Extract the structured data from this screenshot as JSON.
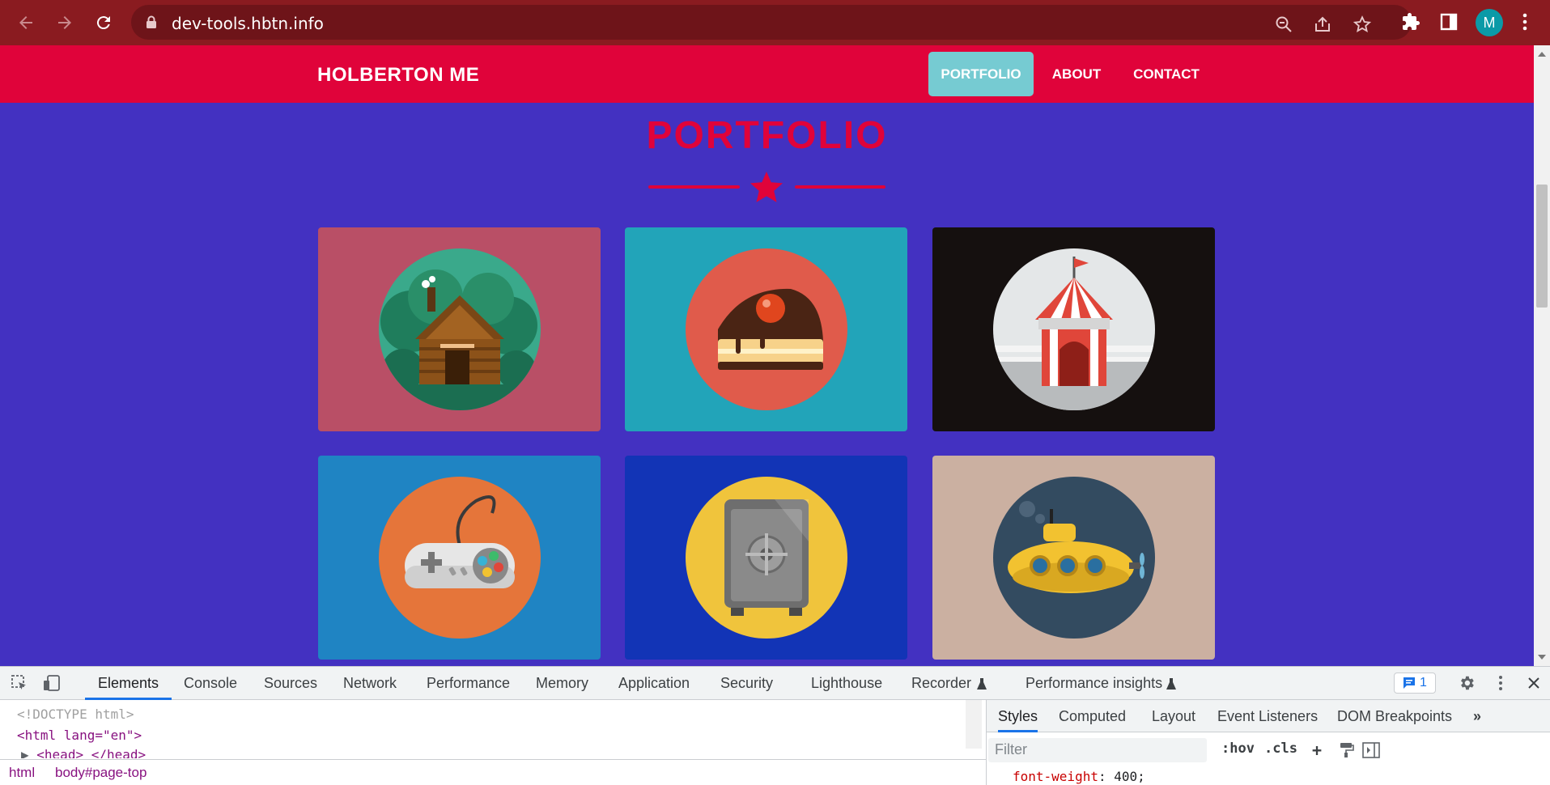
{
  "browser": {
    "url": "dev-tools.hbtn.info",
    "profile_initial": "M"
  },
  "site": {
    "brand": "HOLBERTON ME",
    "menu": [
      "PORTFOLIO",
      "ABOUT",
      "CONTACT"
    ],
    "active_menu": "PORTFOLIO",
    "section_title": "PORTFOLIO",
    "portfolio_items": [
      {
        "icon": "log-cabin-icon",
        "card_color": "#b94f66",
        "circle_color": "#3aa98b"
      },
      {
        "icon": "cake-slice-icon",
        "card_color": "#22a4b9",
        "circle_color": "#e05b4b"
      },
      {
        "icon": "circus-tent-icon",
        "card_color": "#15100f",
        "circle_color": "#e4e7e8"
      },
      {
        "icon": "game-controller-icon",
        "card_color": "#1f84c3",
        "circle_color": "#e5753a"
      },
      {
        "icon": "safe-icon",
        "card_color": "#1234b6",
        "circle_color": "#f0c43c"
      },
      {
        "icon": "submarine-icon",
        "card_color": "#cbb0a1",
        "circle_color": "#334b60"
      }
    ],
    "colors": {
      "page_bg": "#4331c1",
      "navbar": "#e0033a",
      "active_tab": "#76cbd2"
    }
  },
  "devtools": {
    "tabs": [
      "Elements",
      "Console",
      "Sources",
      "Network",
      "Performance",
      "Memory",
      "Application",
      "Security",
      "Lighthouse",
      "Recorder",
      "Performance insights"
    ],
    "active_tab": "Elements",
    "issues_count": "1",
    "dom_lines": [
      "<!DOCTYPE html>",
      "<html lang=\"en\">",
      "<head> </head>"
    ],
    "breadcrumbs": [
      "html",
      "body#page-top"
    ],
    "styles_tabs": [
      "Styles",
      "Computed",
      "Layout",
      "Event Listeners",
      "DOM Breakpoints"
    ],
    "styles_active_tab": "Styles",
    "filter_placeholder": "Filter",
    "filter_tools": [
      ":hov",
      ".cls"
    ],
    "property": {
      "name": "font-weight",
      "value": "400"
    }
  }
}
